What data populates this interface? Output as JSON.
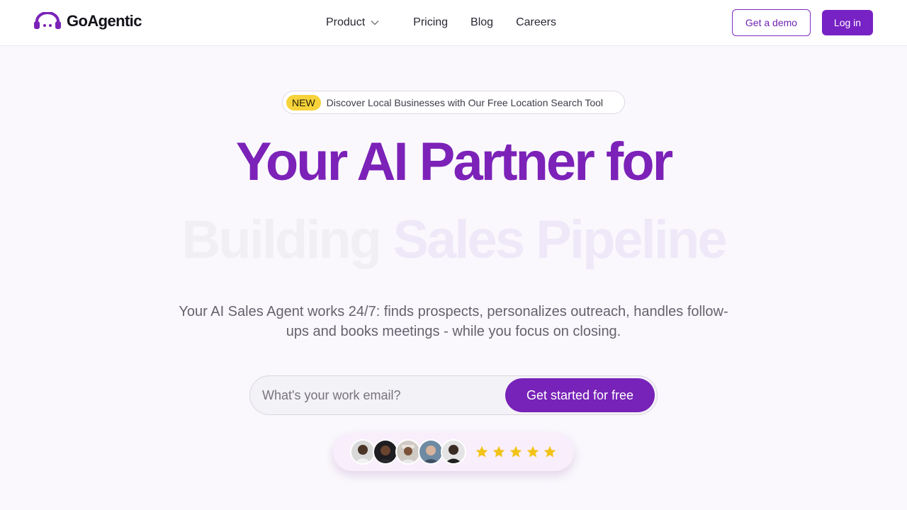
{
  "brand": {
    "name": "GoAgentic",
    "logo_icon": "headphones-logo-icon",
    "accent_color": "#7722c4"
  },
  "nav": {
    "items": [
      {
        "label": "Product",
        "has_dropdown": true
      },
      {
        "label": "Pricing"
      },
      {
        "label": "Blog"
      },
      {
        "label": "Careers"
      }
    ]
  },
  "header_actions": {
    "demo_label": "Get a demo",
    "login_label": "Log in"
  },
  "announcement": {
    "badge": "NEW",
    "text": "Discover Local Businesses with Our Free Location Search Tool"
  },
  "hero": {
    "headline": "Your AI Partner for",
    "rotating_word_1": "Building",
    "rotating_word_2": "Sales Pipeline",
    "description": "Your AI Sales Agent works 24/7: finds prospects, personalizes outreach, handles follow-ups and books meetings - while you focus on closing."
  },
  "signup": {
    "email_placeholder": "What's your work email?",
    "email_value": "",
    "cta_label": "Get started for free"
  },
  "social_proof": {
    "avatars": [
      "customer-avatar-1",
      "customer-avatar-2",
      "customer-avatar-3",
      "customer-avatar-4",
      "customer-avatar-5"
    ],
    "rating": 5,
    "rating_max": 5,
    "star_color": "#f2c318"
  }
}
